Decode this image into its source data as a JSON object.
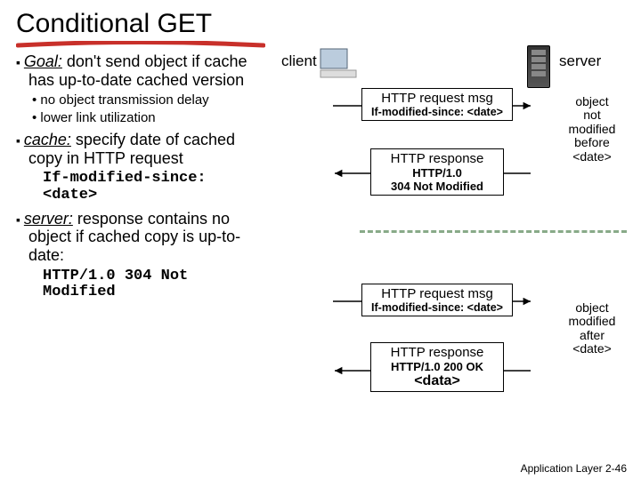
{
  "title": "Conditional GET",
  "bullets": {
    "goal_label": "Goal:",
    "goal_text": " don't send object if cache has up-to-date cached version",
    "sub1": "no object transmission delay",
    "sub2": "lower link utilization",
    "cache_label": "cache:",
    "cache_text": " specify date of cached copy in HTTP request",
    "cache_code": "If-modified-since: <date>",
    "server_label": "server:",
    "server_text": " response contains no object if cached copy is up-to-date:",
    "server_code": "HTTP/1.0 304 Not Modified"
  },
  "labels": {
    "client": "client",
    "server": "server"
  },
  "boxes": {
    "req1_title": "HTTP request msg",
    "req1_sub": "If-modified-since: <date>",
    "resp1_title": "HTTP response",
    "resp1_l1": "HTTP/1.0",
    "resp1_l2": "304 Not Modified",
    "req2_title": "HTTP request msg",
    "req2_sub": "If-modified-since: <date>",
    "resp2_title": "HTTP response",
    "resp2_l1": "HTTP/1.0 200 OK",
    "resp2_data": "<data>"
  },
  "notes": {
    "n1_l1": "object",
    "n1_l2": "not",
    "n1_l3": "modified",
    "n1_l4": "before",
    "n1_l5": "<date>",
    "n2_l1": "object",
    "n2_l2": "modified",
    "n2_l3": "after",
    "n2_l4": "<date>"
  },
  "footer": {
    "text": "Application Layer",
    "page": "2-46"
  }
}
